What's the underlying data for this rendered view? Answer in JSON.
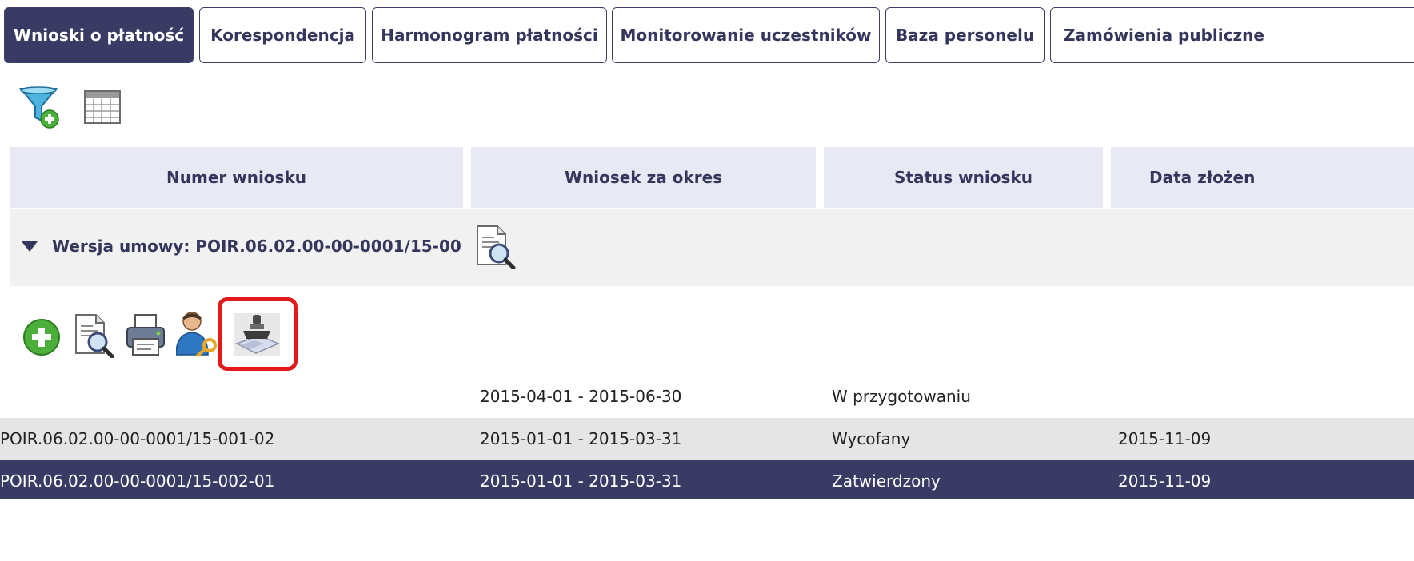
{
  "tabs": [
    {
      "label": "Wnioski o płatność",
      "active": true
    },
    {
      "label": "Korespondencja",
      "active": false
    },
    {
      "label": "Harmonogram płatności",
      "active": false
    },
    {
      "label": "Monitorowanie uczestników",
      "active": false
    },
    {
      "label": "Baza personelu",
      "active": false
    },
    {
      "label": "Zamówienia publiczne",
      "active": false
    }
  ],
  "toolbar": {
    "icons": [
      "add-filter-icon",
      "table-view-icon"
    ]
  },
  "table": {
    "columns": [
      "Numer wniosku",
      "Wniosek za okres",
      "Status wniosku",
      "Data złożen"
    ],
    "group": {
      "label": "Wersja umowy: POIR.06.02.00-00-0001/15-00"
    },
    "actions": [
      "add-icon",
      "preview-icon",
      "print-icon",
      "user-key-icon",
      "stamp-icon"
    ],
    "rows": [
      {
        "number": "",
        "period": "2015-04-01 - 2015-06-30",
        "status": "W przygotowaniu",
        "date": ""
      },
      {
        "number": "POIR.06.02.00-00-0001/15-001-02",
        "period": "2015-01-01 - 2015-03-31",
        "status": "Wycofany",
        "date": "2015-11-09"
      },
      {
        "number": "POIR.06.02.00-00-0001/15-002-01",
        "period": "2015-01-01 - 2015-03-31",
        "status": "Zatwierdzony",
        "date": "2015-11-09"
      }
    ]
  },
  "colors": {
    "accent": "#393b64",
    "header_bg": "#e8e9f5",
    "highlight": "#e11b1b"
  }
}
